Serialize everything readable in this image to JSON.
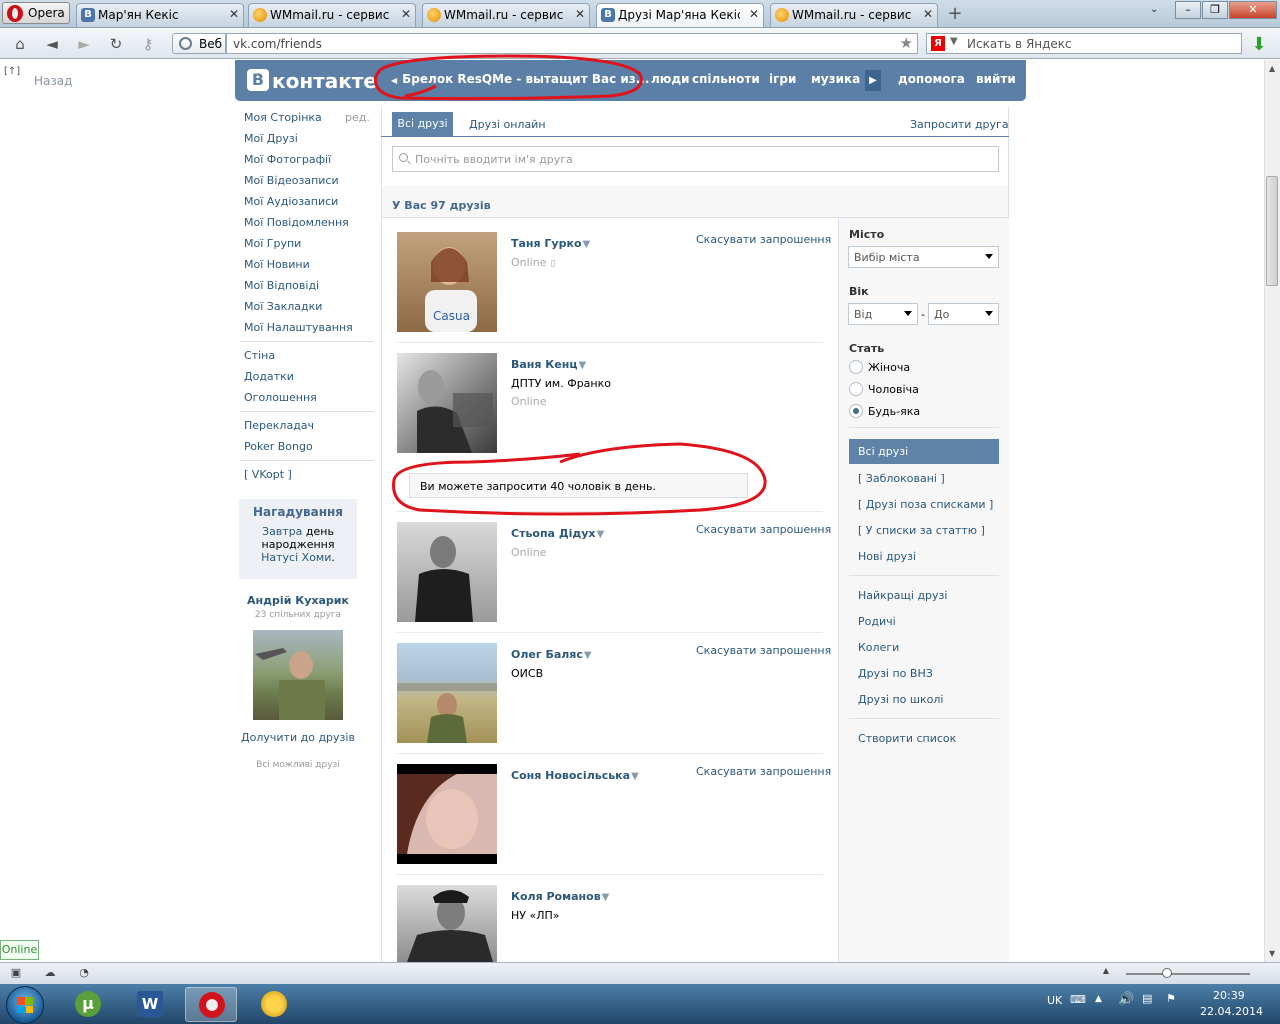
{
  "browser": {
    "menu_label": "Opera",
    "tabs": [
      {
        "label": "Мар'ян Кекіс",
        "icon": "vk-favicon",
        "active": false
      },
      {
        "label": "WMmail.ru - сервис п...",
        "icon": "wmmail-favicon",
        "active": false
      },
      {
        "label": "WMmail.ru - сервис п...",
        "icon": "wmmail-favicon",
        "active": false
      },
      {
        "label": "Друзі Мар'яна Кекіса |...",
        "icon": "vk-favicon",
        "active": true
      },
      {
        "label": "WMmail.ru - сервис п...",
        "icon": "wmmail-favicon",
        "active": false
      }
    ],
    "web_button": "Веб",
    "url": "vk.com/friends",
    "search_placeholder": "Искать в Яндекс",
    "back_label": "Назад",
    "back_icon_glyph": "[↑]"
  },
  "vk_header": {
    "logo_text": "контакте",
    "logo_letter": "В",
    "ad_text": "Брелок ResQMe - вытащит Вас из...",
    "nav": [
      "люди",
      "спільноти",
      "ігри",
      "музика",
      "допомога",
      "вийти"
    ]
  },
  "left_menu": {
    "edit_label": "ред.",
    "group1": [
      "Моя Сторінка",
      "Мої Друзі",
      "Мої Фотографії",
      "Мої Відеозаписи",
      "Мої Аудіозаписи",
      "Мої Повідомлення",
      "Мої Групи",
      "Мої Новини",
      "Мої Відповіді",
      "Мої Закладки",
      "Мої Налаштування"
    ],
    "group2": [
      "Стіна",
      "Додатки",
      "Оголошення"
    ],
    "group3": [
      "Перекладач",
      "Poker Bongo"
    ],
    "group4": [
      "[ VKopt ]"
    ]
  },
  "reminder": {
    "title": "Нагадування",
    "t1": "Завтра",
    "t2": " день народження ",
    "t3": "Натусі Хоми",
    "t4": "."
  },
  "suggestion": {
    "name": "Андрій Кухарик",
    "common": "23 спільних друга",
    "add_label": "Долучити до друзів",
    "all_label": "Всі можливі друзі"
  },
  "friends_page": {
    "tab_all": "Всі друзі",
    "tab_online": "Друзі онлайн",
    "invite_link": "Запросити друга",
    "search_placeholder": "Почніть вводити ім'я друга",
    "count_text": "У Вас 97 друзів",
    "cancel_label": "Скасувати запрошення",
    "notice": "Ви можете запросити 40 чоловік в день.",
    "friends": [
      {
        "name": "Таня Гурко",
        "sub": "",
        "online": "Online",
        "mobile": true,
        "cancel": true
      },
      {
        "name": "Ваня Кенц",
        "sub": "ДПТУ им. Франко",
        "online": "Online",
        "mobile": false,
        "cancel": false
      },
      {
        "name": "Стьопа Дідух",
        "sub": "",
        "online": "Online",
        "mobile": false,
        "cancel": true
      },
      {
        "name": "Олег Баляс",
        "sub": "ОИСВ",
        "online": "",
        "mobile": false,
        "cancel": true
      },
      {
        "name": "Соня Новосільська",
        "sub": "",
        "online": "",
        "mobile": false,
        "cancel": true
      },
      {
        "name": "Коля Романов",
        "sub": "НУ «ЛП»",
        "online": "",
        "mobile": false,
        "cancel": false
      }
    ]
  },
  "filters": {
    "city_label": "Місто",
    "city_value": "Вибір міста",
    "age_label": "Вік",
    "age_from": "Від",
    "age_dash": "-",
    "age_to": "До",
    "sex_label": "Стать",
    "sex_options": [
      "Жіноча",
      "Чоловіча",
      "Будь-яка"
    ],
    "sex_selected": 2,
    "lists_active": "Всі друзі",
    "lists_a": [
      "[ Заблоковані ]",
      "[ Друзі поза списками ]",
      "[ У списки за статтю ]",
      "Нові друзі"
    ],
    "lists_b": [
      "Найкращі друзі",
      "Родичі",
      "Колеги",
      "Друзі по ВНЗ",
      "Друзі по школі"
    ],
    "create_list": "Створити список"
  },
  "status": {
    "online_tag": "Online"
  },
  "taskbar": {
    "lang": "UK",
    "time": "20:39",
    "date": "22.04.2014"
  },
  "colors": {
    "vk_blue": "#5b7fa6",
    "link": "#2b587a",
    "annotation_red": "#e0121a"
  }
}
